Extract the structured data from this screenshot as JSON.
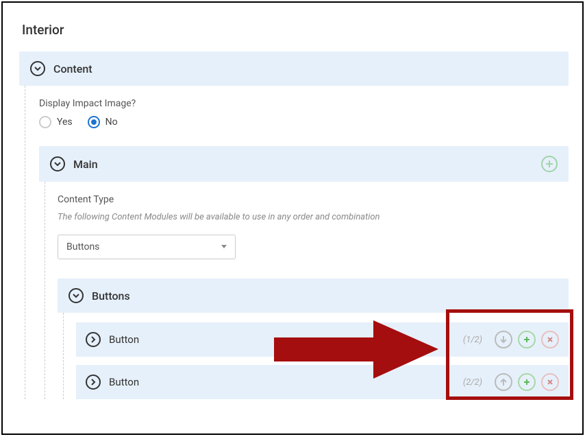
{
  "page": {
    "title": "Interior"
  },
  "content": {
    "header": "Content",
    "display_impact": {
      "label": "Display Impact Image?",
      "yes": "Yes",
      "no": "No",
      "selected": "No"
    }
  },
  "main": {
    "header": "Main",
    "content_type": {
      "label": "Content Type",
      "description": "The following Content Modules will be available to use in any order and combination",
      "selected": "Buttons"
    },
    "buttons_group": {
      "header": "Buttons",
      "items": [
        {
          "label": "Button",
          "index": "(1/2)"
        },
        {
          "label": "Button",
          "index": "(2/2)"
        }
      ]
    }
  }
}
